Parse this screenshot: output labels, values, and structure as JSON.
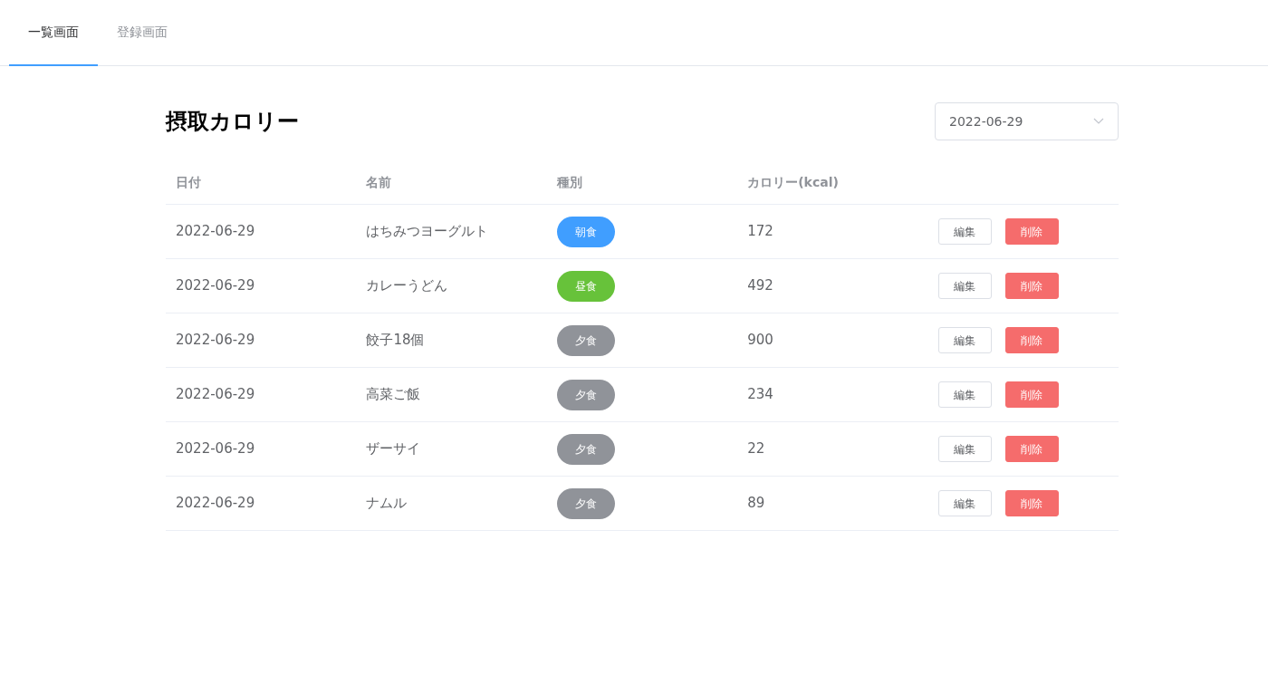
{
  "tabs": [
    {
      "label": "一覧画面",
      "selected": true
    },
    {
      "label": "登録画面",
      "selected": false
    }
  ],
  "title": "摂取カロリー",
  "date_select": {
    "value": "2022-06-29"
  },
  "table": {
    "columns": [
      "日付",
      "名前",
      "種別",
      "カロリー(kcal)"
    ],
    "rows": [
      {
        "date": "2022-06-29",
        "name": "はちみつヨーグルト",
        "meal": {
          "label": "朝食",
          "color": "#409eff"
        },
        "calories": "172",
        "actions": [
          {
            "label": "編集",
            "kind": "plain"
          },
          {
            "label": "削除",
            "kind": "danger"
          }
        ]
      },
      {
        "date": "2022-06-29",
        "name": "カレーうどん",
        "meal": {
          "label": "昼食",
          "color": "#67c23a"
        },
        "calories": "492",
        "actions": [
          {
            "label": "編集",
            "kind": "plain"
          },
          {
            "label": "削除",
            "kind": "danger"
          }
        ]
      },
      {
        "date": "2022-06-29",
        "name": "餃子18個",
        "meal": {
          "label": "夕食",
          "color": "#909399"
        },
        "calories": "900",
        "actions": [
          {
            "label": "編集",
            "kind": "plain"
          },
          {
            "label": "削除",
            "kind": "danger"
          }
        ]
      },
      {
        "date": "2022-06-29",
        "name": "高菜ご飯",
        "meal": {
          "label": "夕食",
          "color": "#909399"
        },
        "calories": "234",
        "actions": [
          {
            "label": "編集",
            "kind": "plain"
          },
          {
            "label": "削除",
            "kind": "danger"
          }
        ]
      },
      {
        "date": "2022-06-29",
        "name": "ザーサイ",
        "meal": {
          "label": "夕食",
          "color": "#909399"
        },
        "calories": "22",
        "actions": [
          {
            "label": "編集",
            "kind": "plain"
          },
          {
            "label": "削除",
            "kind": "danger"
          }
        ]
      },
      {
        "date": "2022-06-29",
        "name": "ナムル",
        "meal": {
          "label": "夕食",
          "color": "#909399"
        },
        "calories": "89",
        "actions": [
          {
            "label": "編集",
            "kind": "plain"
          },
          {
            "label": "削除",
            "kind": "danger"
          }
        ]
      }
    ]
  }
}
